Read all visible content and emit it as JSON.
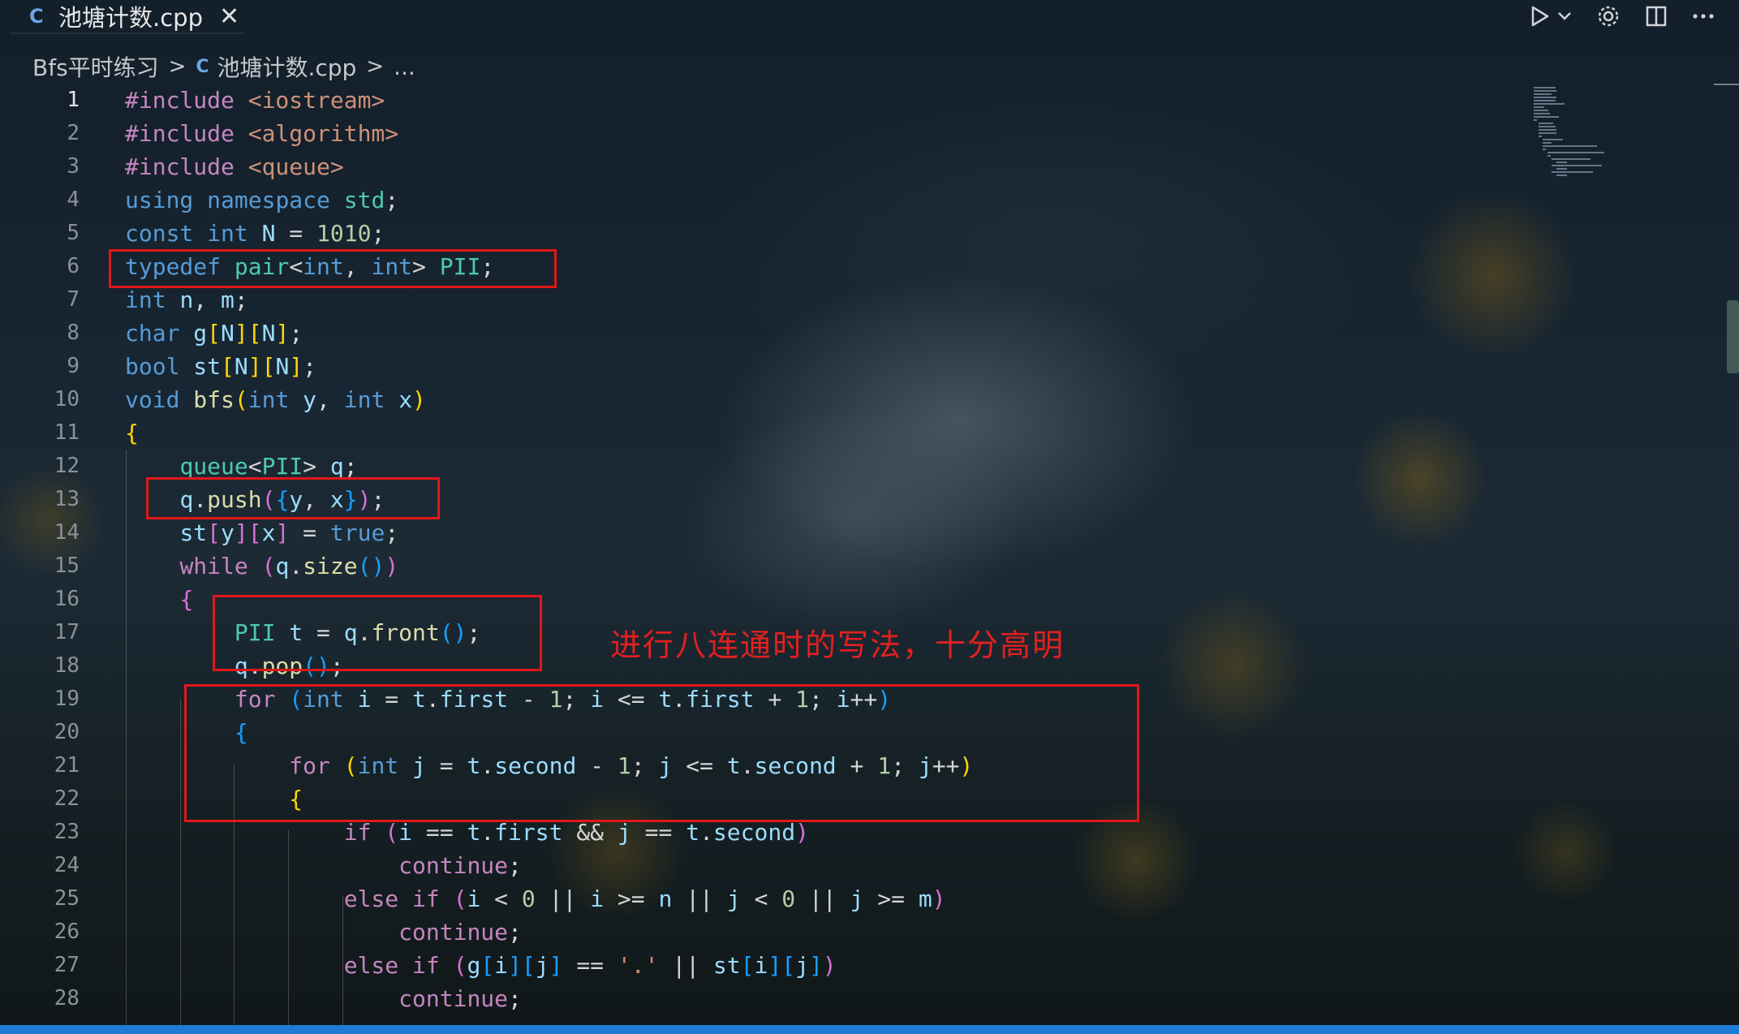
{
  "tab": {
    "icon": "cpp-file-icon",
    "title": "池塘计数.cpp",
    "close": "✕"
  },
  "toolbar": {
    "run": "run-icon",
    "run_dropdown": "chevron-down-icon",
    "settings": "gear-icon",
    "split": "split-editor-icon",
    "more": "more-icon"
  },
  "breadcrumb": {
    "folder": "Bfs平时练习",
    "file": "池塘计数.cpp",
    "ellipsis": "...",
    "separator": ">"
  },
  "editor": {
    "active_line": 1,
    "line_numbers": [
      "1",
      "2",
      "3",
      "4",
      "5",
      "6",
      "7",
      "8",
      "9",
      "10",
      "11",
      "12",
      "13",
      "14",
      "15",
      "16",
      "17",
      "18",
      "19",
      "20",
      "21",
      "22",
      "23",
      "24",
      "25",
      "26",
      "27",
      "28"
    ],
    "lines": [
      [
        [
          "#include",
          "pp"
        ],
        [
          " ",
          "plain"
        ],
        [
          "<iostream>",
          "str"
        ]
      ],
      [
        [
          "#include",
          "pp"
        ],
        [
          " ",
          "plain"
        ],
        [
          "<algorithm>",
          "str"
        ]
      ],
      [
        [
          "#include",
          "pp"
        ],
        [
          " ",
          "plain"
        ],
        [
          "<queue>",
          "str"
        ]
      ],
      [
        [
          "using",
          "kw"
        ],
        [
          " ",
          "plain"
        ],
        [
          "namespace",
          "kw"
        ],
        [
          " ",
          "plain"
        ],
        [
          "std",
          "type"
        ],
        [
          ";",
          "plain"
        ]
      ],
      [
        [
          "const",
          "kw"
        ],
        [
          " ",
          "plain"
        ],
        [
          "int",
          "kw"
        ],
        [
          " ",
          "plain"
        ],
        [
          "N",
          "var"
        ],
        [
          " = ",
          "plain"
        ],
        [
          "1010",
          "num"
        ],
        [
          ";",
          "plain"
        ]
      ],
      [
        [
          "typedef",
          "kw"
        ],
        [
          " ",
          "plain"
        ],
        [
          "pair",
          "type"
        ],
        [
          "<",
          "plain"
        ],
        [
          "int",
          "kw"
        ],
        [
          ", ",
          "plain"
        ],
        [
          "int",
          "kw"
        ],
        [
          "> ",
          "plain"
        ],
        [
          "PII",
          "type"
        ],
        [
          ";",
          "plain"
        ]
      ],
      [
        [
          "int",
          "kw"
        ],
        [
          " ",
          "plain"
        ],
        [
          "n",
          "var"
        ],
        [
          ", ",
          "plain"
        ],
        [
          "m",
          "var"
        ],
        [
          ";",
          "plain"
        ]
      ],
      [
        [
          "char",
          "kw"
        ],
        [
          " ",
          "plain"
        ],
        [
          "g",
          "var"
        ],
        [
          "[",
          "br1"
        ],
        [
          "N",
          "var"
        ],
        [
          "]",
          "br1"
        ],
        [
          "[",
          "br1"
        ],
        [
          "N",
          "var"
        ],
        [
          "]",
          "br1"
        ],
        [
          ";",
          "plain"
        ]
      ],
      [
        [
          "bool",
          "kw"
        ],
        [
          " ",
          "plain"
        ],
        [
          "st",
          "var"
        ],
        [
          "[",
          "br1"
        ],
        [
          "N",
          "var"
        ],
        [
          "]",
          "br1"
        ],
        [
          "[",
          "br1"
        ],
        [
          "N",
          "var"
        ],
        [
          "]",
          "br1"
        ],
        [
          ";",
          "plain"
        ]
      ],
      [
        [
          "void",
          "kw"
        ],
        [
          " ",
          "plain"
        ],
        [
          "bfs",
          "fn"
        ],
        [
          "(",
          "br1"
        ],
        [
          "int",
          "kw"
        ],
        [
          " ",
          "plain"
        ],
        [
          "y",
          "var"
        ],
        [
          ", ",
          "plain"
        ],
        [
          "int",
          "kw"
        ],
        [
          " ",
          "plain"
        ],
        [
          "x",
          "var"
        ],
        [
          ")",
          "br1"
        ]
      ],
      [
        [
          "{",
          "br1"
        ]
      ],
      [
        [
          "    ",
          "plain"
        ],
        [
          "queue",
          "type"
        ],
        [
          "<",
          "plain"
        ],
        [
          "PII",
          "type"
        ],
        [
          "> ",
          "plain"
        ],
        [
          "q",
          "var"
        ],
        [
          ";",
          "plain"
        ]
      ],
      [
        [
          "    ",
          "plain"
        ],
        [
          "q",
          "var"
        ],
        [
          ".",
          "plain"
        ],
        [
          "push",
          "fn"
        ],
        [
          "(",
          "br2"
        ],
        [
          "{",
          "br3"
        ],
        [
          "y",
          "var"
        ],
        [
          ", ",
          "plain"
        ],
        [
          "x",
          "var"
        ],
        [
          "}",
          "br3"
        ],
        [
          ")",
          "br2"
        ],
        [
          ";",
          "plain"
        ]
      ],
      [
        [
          "    ",
          "plain"
        ],
        [
          "st",
          "var"
        ],
        [
          "[",
          "br2"
        ],
        [
          "y",
          "var"
        ],
        [
          "]",
          "br2"
        ],
        [
          "[",
          "br2"
        ],
        [
          "x",
          "var"
        ],
        [
          "]",
          "br2"
        ],
        [
          " = ",
          "plain"
        ],
        [
          "true",
          "kw"
        ],
        [
          ";",
          "plain"
        ]
      ],
      [
        [
          "    ",
          "plain"
        ],
        [
          "while",
          "ctl"
        ],
        [
          " ",
          "plain"
        ],
        [
          "(",
          "br2"
        ],
        [
          "q",
          "var"
        ],
        [
          ".",
          "plain"
        ],
        [
          "size",
          "fn"
        ],
        [
          "()",
          "br3"
        ],
        [
          ")",
          "br2"
        ]
      ],
      [
        [
          "    ",
          "plain"
        ],
        [
          "{",
          "br2"
        ]
      ],
      [
        [
          "        ",
          "plain"
        ],
        [
          "PII",
          "type"
        ],
        [
          " ",
          "plain"
        ],
        [
          "t",
          "var"
        ],
        [
          " = ",
          "plain"
        ],
        [
          "q",
          "var"
        ],
        [
          ".",
          "plain"
        ],
        [
          "front",
          "fn"
        ],
        [
          "()",
          "br3"
        ],
        [
          ";",
          "plain"
        ]
      ],
      [
        [
          "        ",
          "plain"
        ],
        [
          "q",
          "var"
        ],
        [
          ".",
          "plain"
        ],
        [
          "pop",
          "fn"
        ],
        [
          "()",
          "br3"
        ],
        [
          ";",
          "plain"
        ]
      ],
      [
        [
          "        ",
          "plain"
        ],
        [
          "for",
          "ctl"
        ],
        [
          " ",
          "plain"
        ],
        [
          "(",
          "br3"
        ],
        [
          "int",
          "kw"
        ],
        [
          " ",
          "plain"
        ],
        [
          "i",
          "var"
        ],
        [
          " = ",
          "plain"
        ],
        [
          "t",
          "var"
        ],
        [
          ".",
          "plain"
        ],
        [
          "first",
          "var"
        ],
        [
          " - ",
          "plain"
        ],
        [
          "1",
          "num"
        ],
        [
          "; ",
          "plain"
        ],
        [
          "i",
          "var"
        ],
        [
          " <= ",
          "plain"
        ],
        [
          "t",
          "var"
        ],
        [
          ".",
          "plain"
        ],
        [
          "first",
          "var"
        ],
        [
          " + ",
          "plain"
        ],
        [
          "1",
          "num"
        ],
        [
          "; ",
          "plain"
        ],
        [
          "i",
          "var"
        ],
        [
          "++",
          "plain"
        ],
        [
          ")",
          "br3"
        ]
      ],
      [
        [
          "        ",
          "plain"
        ],
        [
          "{",
          "br3"
        ]
      ],
      [
        [
          "            ",
          "plain"
        ],
        [
          "for",
          "ctl"
        ],
        [
          " ",
          "plain"
        ],
        [
          "(",
          "br1"
        ],
        [
          "int",
          "kw"
        ],
        [
          " ",
          "plain"
        ],
        [
          "j",
          "var"
        ],
        [
          " = ",
          "plain"
        ],
        [
          "t",
          "var"
        ],
        [
          ".",
          "plain"
        ],
        [
          "second",
          "var"
        ],
        [
          " - ",
          "plain"
        ],
        [
          "1",
          "num"
        ],
        [
          "; ",
          "plain"
        ],
        [
          "j",
          "var"
        ],
        [
          " <= ",
          "plain"
        ],
        [
          "t",
          "var"
        ],
        [
          ".",
          "plain"
        ],
        [
          "second",
          "var"
        ],
        [
          " + ",
          "plain"
        ],
        [
          "1",
          "num"
        ],
        [
          "; ",
          "plain"
        ],
        [
          "j",
          "var"
        ],
        [
          "++",
          "plain"
        ],
        [
          ")",
          "br1"
        ]
      ],
      [
        [
          "            ",
          "plain"
        ],
        [
          "{",
          "br1"
        ]
      ],
      [
        [
          "                ",
          "plain"
        ],
        [
          "if",
          "ctl"
        ],
        [
          " ",
          "plain"
        ],
        [
          "(",
          "br2"
        ],
        [
          "i",
          "var"
        ],
        [
          " == ",
          "plain"
        ],
        [
          "t",
          "var"
        ],
        [
          ".",
          "plain"
        ],
        [
          "first",
          "var"
        ],
        [
          " && ",
          "plain"
        ],
        [
          "j",
          "var"
        ],
        [
          " == ",
          "plain"
        ],
        [
          "t",
          "var"
        ],
        [
          ".",
          "plain"
        ],
        [
          "second",
          "var"
        ],
        [
          ")",
          "br2"
        ]
      ],
      [
        [
          "                    ",
          "plain"
        ],
        [
          "continue",
          "ctl"
        ],
        [
          ";",
          "plain"
        ]
      ],
      [
        [
          "                ",
          "plain"
        ],
        [
          "else",
          "ctl"
        ],
        [
          " ",
          "plain"
        ],
        [
          "if",
          "ctl"
        ],
        [
          " ",
          "plain"
        ],
        [
          "(",
          "br2"
        ],
        [
          "i",
          "var"
        ],
        [
          " < ",
          "plain"
        ],
        [
          "0",
          "num"
        ],
        [
          " || ",
          "plain"
        ],
        [
          "i",
          "var"
        ],
        [
          " >= ",
          "plain"
        ],
        [
          "n",
          "var"
        ],
        [
          " || ",
          "plain"
        ],
        [
          "j",
          "var"
        ],
        [
          " < ",
          "plain"
        ],
        [
          "0",
          "num"
        ],
        [
          " || ",
          "plain"
        ],
        [
          "j",
          "var"
        ],
        [
          " >= ",
          "plain"
        ],
        [
          "m",
          "var"
        ],
        [
          ")",
          "br2"
        ]
      ],
      [
        [
          "                    ",
          "plain"
        ],
        [
          "continue",
          "ctl"
        ],
        [
          ";",
          "plain"
        ]
      ],
      [
        [
          "                ",
          "plain"
        ],
        [
          "else",
          "ctl"
        ],
        [
          " ",
          "plain"
        ],
        [
          "if",
          "ctl"
        ],
        [
          " ",
          "plain"
        ],
        [
          "(",
          "br2"
        ],
        [
          "g",
          "var"
        ],
        [
          "[",
          "br3"
        ],
        [
          "i",
          "var"
        ],
        [
          "]",
          "br3"
        ],
        [
          "[",
          "br3"
        ],
        [
          "j",
          "var"
        ],
        [
          "]",
          "br3"
        ],
        [
          " == ",
          "plain"
        ],
        [
          "'.'",
          "str"
        ],
        [
          " || ",
          "plain"
        ],
        [
          "st",
          "var"
        ],
        [
          "[",
          "br3"
        ],
        [
          "i",
          "var"
        ],
        [
          "]",
          "br3"
        ],
        [
          "[",
          "br3"
        ],
        [
          "j",
          "var"
        ],
        [
          "]",
          "br3"
        ],
        [
          ")",
          "br2"
        ]
      ],
      [
        [
          "                    ",
          "plain"
        ],
        [
          "continue",
          "ctl"
        ],
        [
          ";",
          "plain"
        ]
      ]
    ]
  },
  "annotation": {
    "text": "进行八连通时的写法，十分高明",
    "color": "#e01818"
  },
  "colors": {
    "keyword": "#569cd6",
    "control": "#c586c0",
    "type": "#4ec9b0",
    "variable": "#9cdcfe",
    "function": "#dcdcaa",
    "number": "#b5cea8",
    "string": "#ce9178",
    "status_bar": "#1d7dd6"
  }
}
